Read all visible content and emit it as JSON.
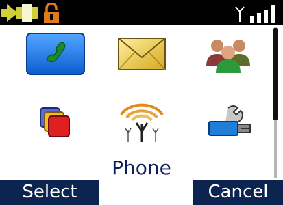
{
  "status_bar": {
    "icons": [
      "battery-icon",
      "keypad-lock-icon",
      "antenna-icon",
      "signal-strength-icon"
    ],
    "signal_bars": 4
  },
  "menu": {
    "items": [
      {
        "icon": "phone-icon",
        "selected": true
      },
      {
        "icon": "envelope-icon",
        "selected": false
      },
      {
        "icon": "contacts-icon",
        "selected": false
      },
      {
        "icon": "stacked-squares-icon",
        "selected": false
      },
      {
        "icon": "radio-tower-icon",
        "selected": false
      },
      {
        "icon": "settings-tools-icon",
        "selected": false
      }
    ],
    "selected_label": "Phone"
  },
  "softkeys": {
    "left": "Select",
    "right": "Cancel"
  },
  "colors": {
    "status_bar_bg": "#000000",
    "softkey_bg": "#0b2450",
    "selection_bg": "#1e7ee8",
    "label_text": "#0b1d5a"
  }
}
